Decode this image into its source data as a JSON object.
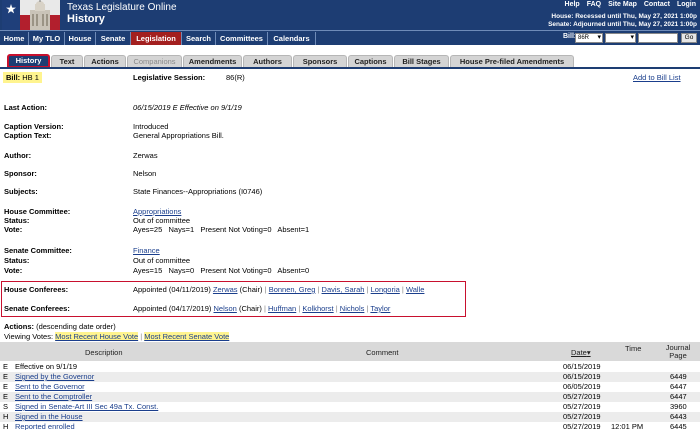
{
  "header": {
    "site_title": "Texas Legislature Online",
    "page_title": "History",
    "toplinks": [
      "Help",
      "FAQ",
      "Site Map",
      "Contact",
      "Login"
    ],
    "house_status": "House: Recessed until Thu, May 27, 2021 1:00p",
    "senate_status": "Senate: Adjourned until Thu, May 27, 2021 1:00p"
  },
  "nav": {
    "items": [
      "Home",
      "My TLO",
      "House",
      "Senate",
      "Legislation",
      "Search",
      "Committees",
      "Calendars"
    ],
    "active": "Legislation",
    "bill_label": "Bill:",
    "session_value": "86R",
    "go_label": "Go"
  },
  "tabs": [
    "History",
    "Text",
    "Actions",
    "Companions",
    "Amendments",
    "Authors",
    "Sponsors",
    "Captions",
    "Bill Stages",
    "House Pre-filed Amendments"
  ],
  "bill": {
    "label": "Bill:",
    "number": "HB 1",
    "session_label": "Legislative Session:",
    "session": "86(R)",
    "add_link": "Add to Bill List"
  },
  "info": {
    "last_action_label": "Last Action:",
    "last_action": "06/15/2019 E Effective on 9/1/19",
    "caption_version_label": "Caption Version:",
    "caption_version": "Introduced",
    "caption_text_label": "Caption Text:",
    "caption_text": "General Appropriations Bill.",
    "author_label": "Author:",
    "author": "Zerwas",
    "sponsor_label": "Sponsor:",
    "sponsor": "Nelson",
    "subjects_label": "Subjects:",
    "subjects": "State Finances--Appropriations (I0746)"
  },
  "house_committee": {
    "label": "House Committee:",
    "name": "Appropriations",
    "status_label": "Status:",
    "status": "Out of committee",
    "vote_label": "Vote:",
    "vote": "Ayes=25   Nays=1   Present Not Voting=0   Absent=1"
  },
  "senate_committee": {
    "label": "Senate Committee:",
    "name": "Finance",
    "status_label": "Status:",
    "status": "Out of committee",
    "vote_label": "Vote:",
    "vote": "Ayes=15   Nays=0   Present Not Voting=0   Absent=0"
  },
  "conferees": {
    "house_label": "House Conferees:",
    "house_prefix": "Appointed (04/11/2019)",
    "house_first": "Zerwas",
    "house_chair": "(Chair)",
    "house_members": [
      "Bonnen, Greg",
      "Davis, Sarah",
      "Longoria",
      "Walle"
    ],
    "senate_label": "Senate Conferees:",
    "senate_prefix": "Appointed (04/17/2019)",
    "senate_first": "Nelson",
    "senate_chair": "(Chair)",
    "senate_members": [
      "Huffman",
      "Kolkhorst",
      "Nichols",
      "Taylor"
    ]
  },
  "actions": {
    "label": "Actions:",
    "order_note": "(descending date order)",
    "viewing_label": "Viewing Votes:",
    "house_vote_link": "Most Recent House Vote",
    "senate_vote_link": "Most Recent Senate Vote",
    "columns": [
      "Description",
      "Comment",
      "Date",
      "Time",
      "Journal Page"
    ],
    "rows": [
      {
        "chamber": "E",
        "desc": "Effective on 9/1/19",
        "link": false,
        "date": "06/15/2019",
        "time": "",
        "page": ""
      },
      {
        "chamber": "E",
        "desc": "Signed by the Governor",
        "link": true,
        "date": "06/15/2019",
        "time": "",
        "page": "6449"
      },
      {
        "chamber": "E",
        "desc": "Sent to the Governor",
        "link": true,
        "date": "06/05/2019",
        "time": "",
        "page": "6447"
      },
      {
        "chamber": "E",
        "desc": "Sent to the Comptroller",
        "link": true,
        "date": "05/27/2019",
        "time": "",
        "page": "6447"
      },
      {
        "chamber": "S",
        "desc": "Signed in Senate-Art III Sec 49a Tx. Const.",
        "link": true,
        "date": "05/27/2019",
        "time": "",
        "page": "3960"
      },
      {
        "chamber": "H",
        "desc": "Signed in the House",
        "link": true,
        "date": "05/27/2019",
        "time": "",
        "page": "6443"
      },
      {
        "chamber": "H",
        "desc": "Reported enrolled",
        "link": true,
        "date": "05/27/2019",
        "time": "12:01 PM",
        "page": "6445"
      }
    ]
  }
}
